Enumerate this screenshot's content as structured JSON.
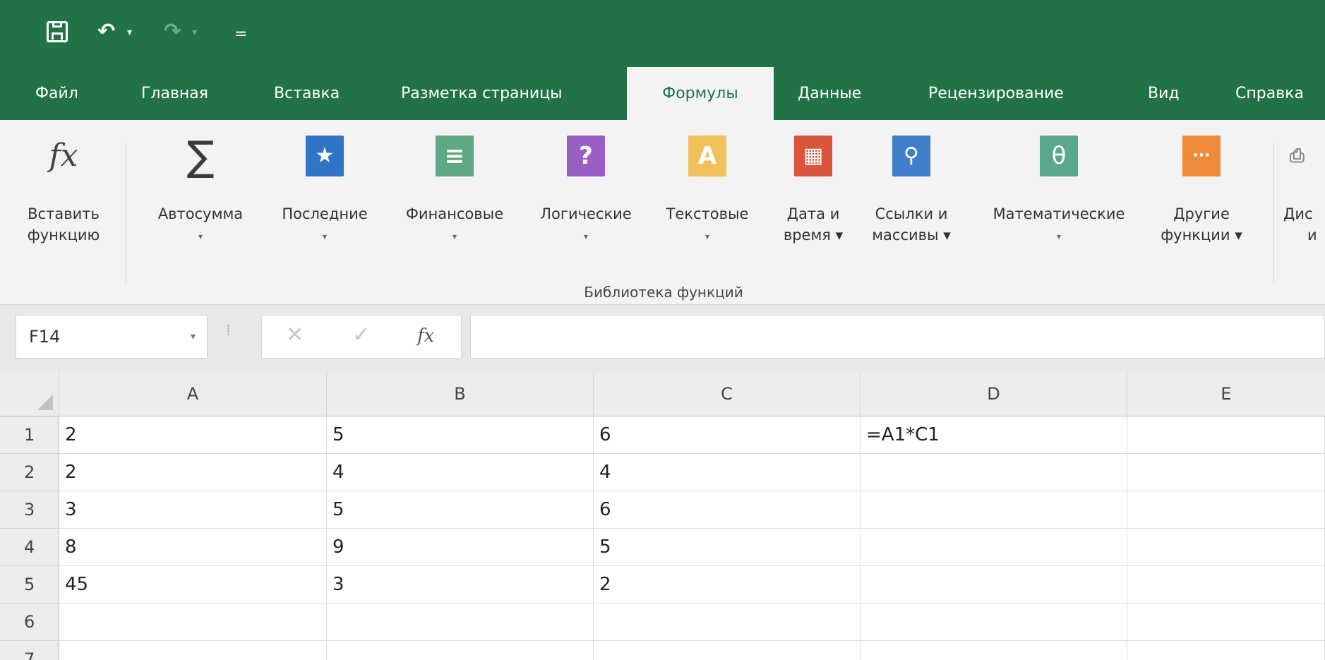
{
  "quick_access": {
    "customize_glyph": "="
  },
  "tabs": [
    {
      "label": "Файл",
      "active": false
    },
    {
      "label": "Главная",
      "active": false
    },
    {
      "label": "Вставка",
      "active": false
    },
    {
      "label": "Разметка страницы",
      "active": false
    },
    {
      "label": "Формулы",
      "active": true
    },
    {
      "label": "Данные",
      "active": false
    },
    {
      "label": "Рецензирование",
      "active": false
    },
    {
      "label": "Вид",
      "active": false
    },
    {
      "label": "Справка",
      "active": false
    }
  ],
  "ribbon": {
    "insert_function": {
      "line1": "Вставить",
      "line2": "функцию",
      "icon": "fx-icon",
      "glyph": "fx"
    },
    "buttons": [
      {
        "line1": "Автосумма",
        "line2": "",
        "icon": "sigma-icon",
        "glyph": "∑",
        "color": "#3a3a3a"
      },
      {
        "line1": "Последние",
        "line2": "",
        "icon": "star-book-icon",
        "glyph": "★",
        "color": "#2f74c7"
      },
      {
        "line1": "Финансовые",
        "line2": "",
        "icon": "finance-book-icon",
        "glyph": "≡",
        "color": "#5ea782"
      },
      {
        "line1": "Логические",
        "line2": "",
        "icon": "logic-book-icon",
        "glyph": "?",
        "color": "#9a5ec7"
      },
      {
        "line1": "Текстовые",
        "line2": "",
        "icon": "text-book-icon",
        "glyph": "A",
        "color": "#f0c15a"
      },
      {
        "line1": "Дата и",
        "line2": "время ▾",
        "icon": "date-book-icon",
        "glyph": "▦",
        "color": "#d9553c"
      },
      {
        "line1": "Ссылки и",
        "line2": "массивы ▾",
        "icon": "lookup-book-icon",
        "glyph": "⚲",
        "color": "#3f7fc9"
      },
      {
        "line1": "Математические",
        "line2": "",
        "icon": "math-book-icon",
        "glyph": "θ",
        "color": "#5aa78f"
      },
      {
        "line1": "Другие",
        "line2": "функции ▾",
        "icon": "more-book-icon",
        "glyph": "···",
        "color": "#ef8a3a"
      },
      {
        "line1": "Дис",
        "line2": "и",
        "icon": "name-manager-icon",
        "glyph": "",
        "color": "#f3f3f3"
      }
    ],
    "dropdown_glyph": "▾",
    "group_label": "Библиотека функций"
  },
  "formula_bar": {
    "name_box": "F14",
    "name_box_caret": "▾",
    "cancel_glyph": "✕",
    "enter_glyph": "✓",
    "fx_glyph": "fx",
    "dots": "⁞",
    "value": ""
  },
  "sheet": {
    "columns": [
      "A",
      "B",
      "C",
      "D",
      "E"
    ],
    "row_headers": [
      "1",
      "2",
      "3",
      "4",
      "5",
      "6",
      "7"
    ],
    "rows": [
      [
        "2",
        "5",
        "6",
        "=A1*C1",
        ""
      ],
      [
        "2",
        "4",
        "4",
        "",
        ""
      ],
      [
        "3",
        "5",
        "6",
        "",
        ""
      ],
      [
        "8",
        "9",
        "5",
        "",
        ""
      ],
      [
        "45",
        "3",
        "2",
        "",
        ""
      ],
      [
        "",
        "",
        "",
        "",
        ""
      ],
      [
        "",
        "",
        "",
        "",
        ""
      ]
    ]
  }
}
